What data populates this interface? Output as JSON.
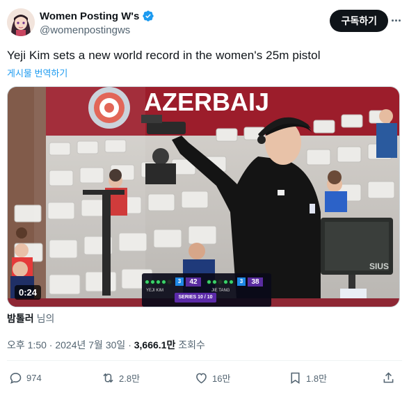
{
  "author": {
    "display_name": "Women Posting W's",
    "handle": "@womenpostingws"
  },
  "subscribe_label": "구독하기",
  "tweet_text": "Yeji Kim sets a new world record in the women's 25m pistol",
  "translate_label": "게시물 번역하기",
  "video": {
    "duration": "0:24",
    "banner_text": "AZERBAIJ",
    "monitor_text": "SIUS",
    "scoreboard": {
      "p1_name": "YEJI KIM",
      "p1_rank": "3",
      "p1_score": "42",
      "p2_name": "JIE TANG",
      "p2_rank": "3",
      "p2_score": "38",
      "series": "SERIES 10 / 10"
    }
  },
  "community_note": {
    "user": "밤톨러",
    "suffix": "님의"
  },
  "meta": {
    "time": "오후 1:50",
    "date": "2024년 7월 30일",
    "views_count": "3,666.1만",
    "views_label": "조회수"
  },
  "actions": {
    "replies": "974",
    "reposts": "2.8만",
    "likes": "16만",
    "bookmarks": "1.8만"
  },
  "colors": {
    "accent": "#1d9bf0",
    "text": "#0f1419",
    "muted": "#536471"
  }
}
